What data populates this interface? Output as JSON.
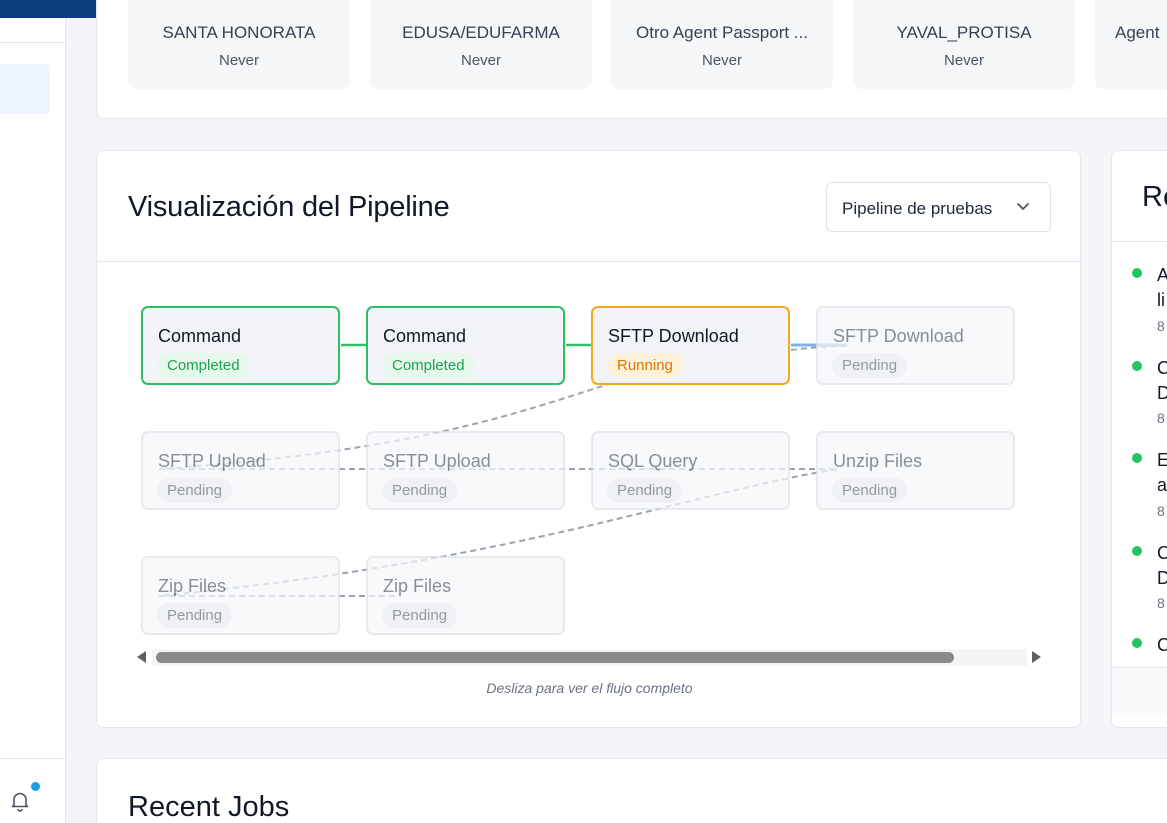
{
  "agents": [
    {
      "name": "SANTA HONORATA",
      "status": "Never"
    },
    {
      "name": "EDUSA/EDUFARMA",
      "status": "Never"
    },
    {
      "name": "Otro Agent Passport ...",
      "status": "Never"
    },
    {
      "name": "YAVAL_PROTISA",
      "status": "Never"
    },
    {
      "name": "Agent",
      "status": ""
    }
  ],
  "pipeline": {
    "title": "Visualización del Pipeline",
    "selected": "Pipeline de pruebas",
    "hint": "Desliza para ver el flujo completo",
    "nodes": [
      {
        "title": "Command",
        "status": "Completed",
        "state": "completed"
      },
      {
        "title": "Command",
        "status": "Completed",
        "state": "completed"
      },
      {
        "title": "SFTP Download",
        "status": "Running",
        "state": "running"
      },
      {
        "title": "SFTP Download",
        "status": "Pending",
        "state": "pending"
      },
      {
        "title": "SFTP Upload",
        "status": "Pending",
        "state": "pending"
      },
      {
        "title": "SFTP Upload",
        "status": "Pending",
        "state": "pending"
      },
      {
        "title": "SQL Query",
        "status": "Pending",
        "state": "pending"
      },
      {
        "title": "Unzip Files",
        "status": "Pending",
        "state": "pending"
      },
      {
        "title": "Zip Files",
        "status": "Pending",
        "state": "pending"
      },
      {
        "title": "Zip Files",
        "status": "Pending",
        "state": "pending"
      }
    ]
  },
  "recent": {
    "title": "Re",
    "items": [
      {
        "l1": "A",
        "l2": "li",
        "l3": "8"
      },
      {
        "l1": "C",
        "l2": "D",
        "l3": "8"
      },
      {
        "l1": "E",
        "l2": "a",
        "l3": "8"
      },
      {
        "l1": "C",
        "l2": "D",
        "l3": "8"
      },
      {
        "l1": "C",
        "l2": "",
        "l3": ""
      }
    ]
  },
  "jobs": {
    "title": "Recent Jobs"
  },
  "colors": {
    "brand": "#0b3f7e",
    "completed": "#2fbf63",
    "running": "#f5a524",
    "notification": "#1e9be9"
  }
}
